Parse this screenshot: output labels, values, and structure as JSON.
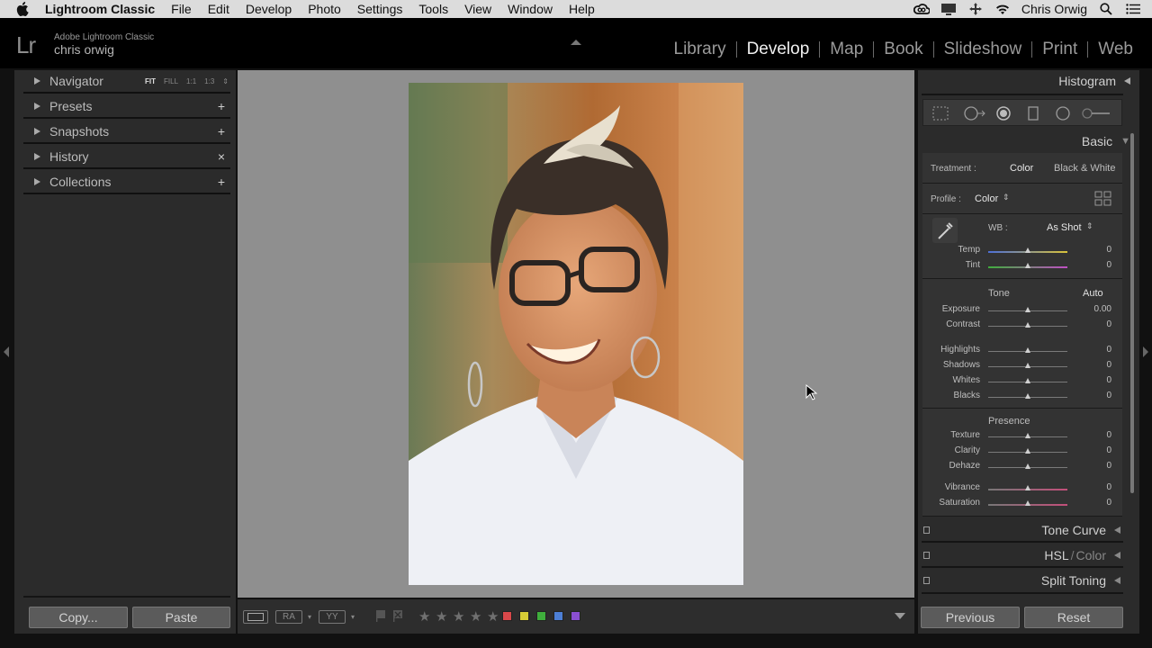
{
  "menubar": {
    "app": "Lightroom Classic",
    "items": [
      "File",
      "Edit",
      "Develop",
      "Photo",
      "Settings",
      "Tools",
      "View",
      "Window",
      "Help"
    ],
    "user": "Chris Orwig"
  },
  "identity": {
    "logo": "Lr",
    "product": "Adobe Lightroom Classic",
    "user": "chris orwig"
  },
  "modules": [
    "Library",
    "Develop",
    "Map",
    "Book",
    "Slideshow",
    "Print",
    "Web"
  ],
  "left_panel": {
    "navigator": {
      "label": "Navigator",
      "zoom": [
        "FIT",
        "FILL",
        "1:1",
        "1:3"
      ]
    },
    "presets": {
      "label": "Presets",
      "action": "+"
    },
    "snapshots": {
      "label": "Snapshots",
      "action": "+"
    },
    "history": {
      "label": "History",
      "action": "×"
    },
    "collections": {
      "label": "Collections",
      "action": "+"
    },
    "copy_label": "Copy...",
    "paste_label": "Paste"
  },
  "right_panel": {
    "histogram_label": "Histogram",
    "basic_label": "Basic",
    "treatment_label": "Treatment :",
    "treatment_color": "Color",
    "treatment_bw": "Black & White",
    "profile_label": "Profile :",
    "profile_value": "Color",
    "wb_label": "WB :",
    "wb_value": "As Shot",
    "temp": {
      "name": "Temp",
      "value": "0"
    },
    "tint": {
      "name": "Tint",
      "value": "0"
    },
    "tone_label": "Tone",
    "auto_label": "Auto",
    "tone_rows": [
      {
        "name": "Exposure",
        "value": "0.00"
      },
      {
        "name": "Contrast",
        "value": "0"
      },
      {
        "name": "Highlights",
        "value": "0"
      },
      {
        "name": "Shadows",
        "value": "0"
      },
      {
        "name": "Whites",
        "value": "0"
      },
      {
        "name": "Blacks",
        "value": "0"
      }
    ],
    "presence_label": "Presence",
    "presence_rows": [
      {
        "name": "Texture",
        "value": "0"
      },
      {
        "name": "Clarity",
        "value": "0"
      },
      {
        "name": "Dehaze",
        "value": "0"
      },
      {
        "name": "Vibrance",
        "value": "0"
      },
      {
        "name": "Saturation",
        "value": "0"
      }
    ],
    "tone_curve_label": "Tone Curve",
    "hsl_label": "HSL",
    "hsl_color_label": "Color",
    "split_toning_label": "Split Toning",
    "previous_label": "Previous",
    "reset_label": "Reset"
  },
  "toolbar": {
    "ra_label": "RA",
    "yy_label": "YY",
    "stars": [
      "★",
      "★",
      "★",
      "★",
      "★"
    ],
    "color_labels": [
      "#d8484a",
      "#d6cc36",
      "#3fae3c",
      "#4d7fd6",
      "#8b4fd1"
    ]
  }
}
